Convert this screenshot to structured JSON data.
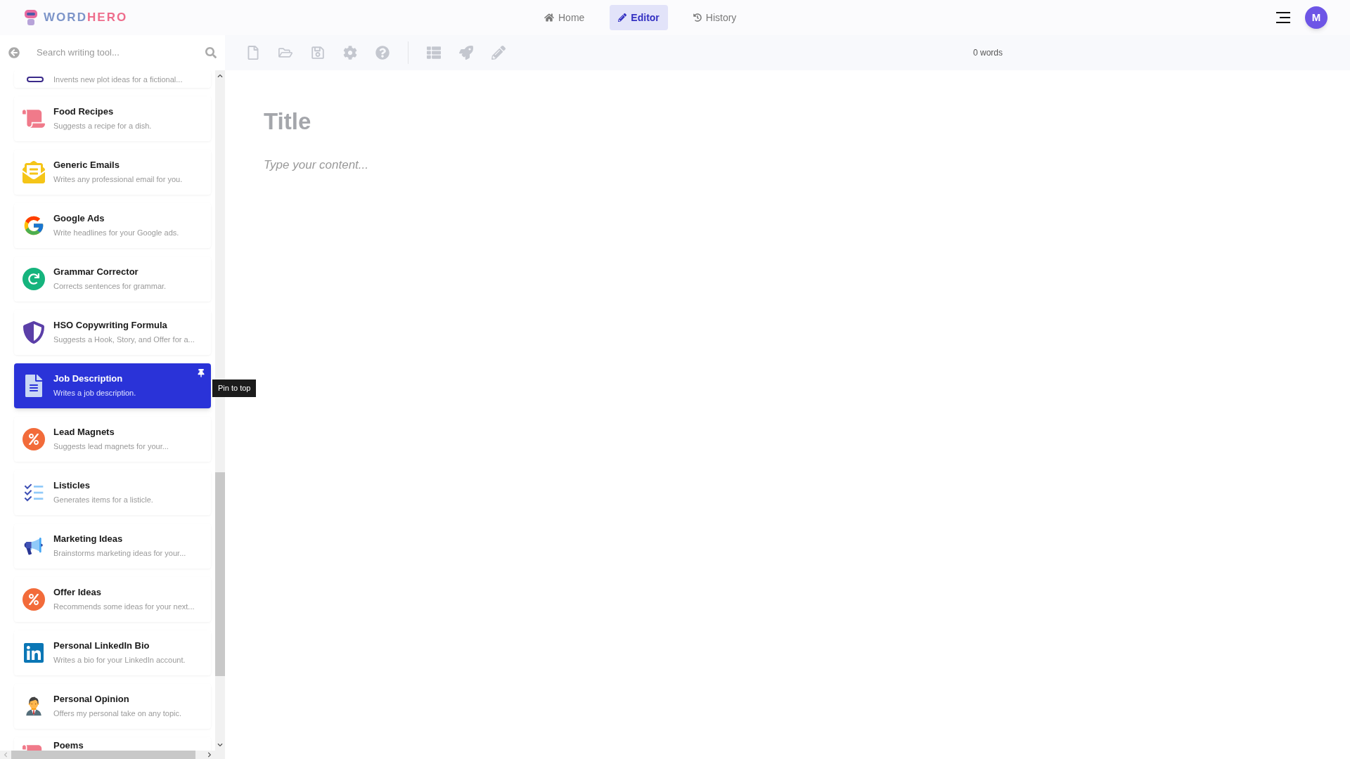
{
  "header": {
    "logo": {
      "word_a": "WORD",
      "word_b": "HERO"
    },
    "nav": [
      {
        "label": "Home",
        "selected": false
      },
      {
        "label": "Editor",
        "selected": true
      },
      {
        "label": "History",
        "selected": false
      }
    ],
    "avatar": {
      "initial": "M"
    }
  },
  "sidebar": {
    "search": {
      "placeholder": "Search writing tool..."
    },
    "tooltip": "Pin to top",
    "tools": [
      {
        "kind": "partial",
        "description": "Invents new plot ideas for a fictional...",
        "selected": false
      },
      {
        "kind": "card",
        "title": "Food Recipes",
        "description": "Suggests a recipe for a dish.",
        "selected": false
      },
      {
        "kind": "card",
        "title": "Generic Emails",
        "description": "Writes any professional email for you.",
        "selected": false
      },
      {
        "kind": "card",
        "title": "Google Ads",
        "description": "Write headlines for your Google ads.",
        "selected": false
      },
      {
        "kind": "card",
        "title": "Grammar Corrector",
        "description": "Corrects sentences for grammar.",
        "selected": false
      },
      {
        "kind": "card",
        "title": "HSO Copywriting Formula",
        "description": "Suggests a Hook, Story, and Offer for a...",
        "selected": false
      },
      {
        "kind": "card",
        "title": "Job Description",
        "description": "Writes a job description.",
        "selected": true
      },
      {
        "kind": "card",
        "title": "Lead Magnets",
        "description": "Suggests lead magnets for your...",
        "selected": false
      },
      {
        "kind": "card",
        "title": "Listicles",
        "description": "Generates items for a listicle.",
        "selected": false
      },
      {
        "kind": "card",
        "title": "Marketing Ideas",
        "description": "Brainstorms marketing ideas for your...",
        "selected": false
      },
      {
        "kind": "card",
        "title": "Offer Ideas",
        "description": "Recommends some ideas for your next...",
        "selected": false
      },
      {
        "kind": "card",
        "title": "Personal LinkedIn Bio",
        "description": "Writes a bio for your LinkedIn account.",
        "selected": false
      },
      {
        "kind": "card",
        "title": "Personal Opinion",
        "description": "Offers my personal take on any topic.",
        "selected": false
      },
      {
        "kind": "titleonly",
        "title": "Poems",
        "selected": false
      }
    ]
  },
  "toolbar": {
    "word_count": "0 words"
  },
  "editor": {
    "title_placeholder": "Title",
    "content_placeholder": "Type your content..."
  }
}
